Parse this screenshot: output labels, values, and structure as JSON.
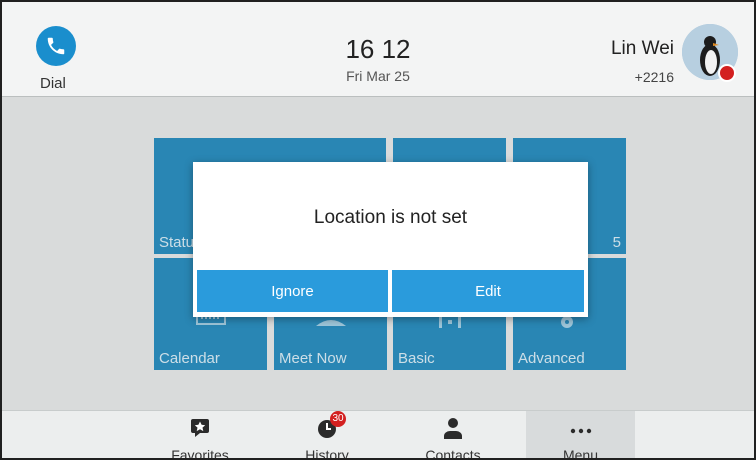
{
  "status_bar": {
    "dial_label": "Dial",
    "time": "16 12",
    "date": "Fri Mar 25",
    "user_name": "Lin Wei",
    "extension": "+2216"
  },
  "tiles": {
    "status_label": "Statu",
    "top_right_fragment": "5",
    "calendar_label": "Calendar",
    "meet_now_label": "Meet Now",
    "basic_label": "Basic",
    "advanced_label": "Advanced"
  },
  "dialog": {
    "message": "Location is not set",
    "ignore_label": "Ignore",
    "edit_label": "Edit"
  },
  "bottom_nav": {
    "favorites_label": "Favorites",
    "history_label": "History",
    "history_badge": "30",
    "contacts_label": "Contacts",
    "menu_label": "Menu"
  },
  "colors": {
    "tile": "#2a8fc0",
    "dialog_button": "#2a9bdc",
    "dial_button": "#1a8ecd",
    "badge": "#d32020"
  }
}
